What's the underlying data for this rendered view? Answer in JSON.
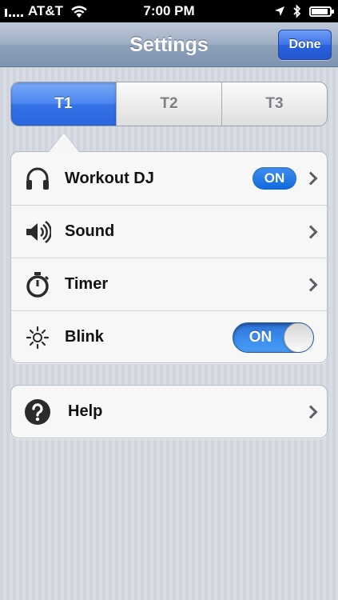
{
  "status_bar": {
    "carrier": "AT&T",
    "time": "7:00 PM"
  },
  "nav_bar": {
    "title": "Settings",
    "done_label": "Done"
  },
  "segmented": {
    "segments": [
      "T1",
      "T2",
      "T3"
    ],
    "selected": "T1"
  },
  "settings": {
    "workout_dj": {
      "label": "Workout DJ",
      "badge": "ON",
      "icon": "headphones-icon"
    },
    "sound": {
      "label": "Sound",
      "icon": "speaker-icon"
    },
    "timer": {
      "label": "Timer",
      "icon": "stopwatch-icon"
    },
    "blink": {
      "label": "Blink",
      "toggle_label": "ON",
      "toggle_on": true,
      "icon": "sun-icon"
    }
  },
  "help": {
    "label": "Help",
    "icon": "question-icon"
  },
  "colors": {
    "accent": "#3472e6",
    "nav_bar": "#8da0b9",
    "badge": "#1168dd"
  }
}
